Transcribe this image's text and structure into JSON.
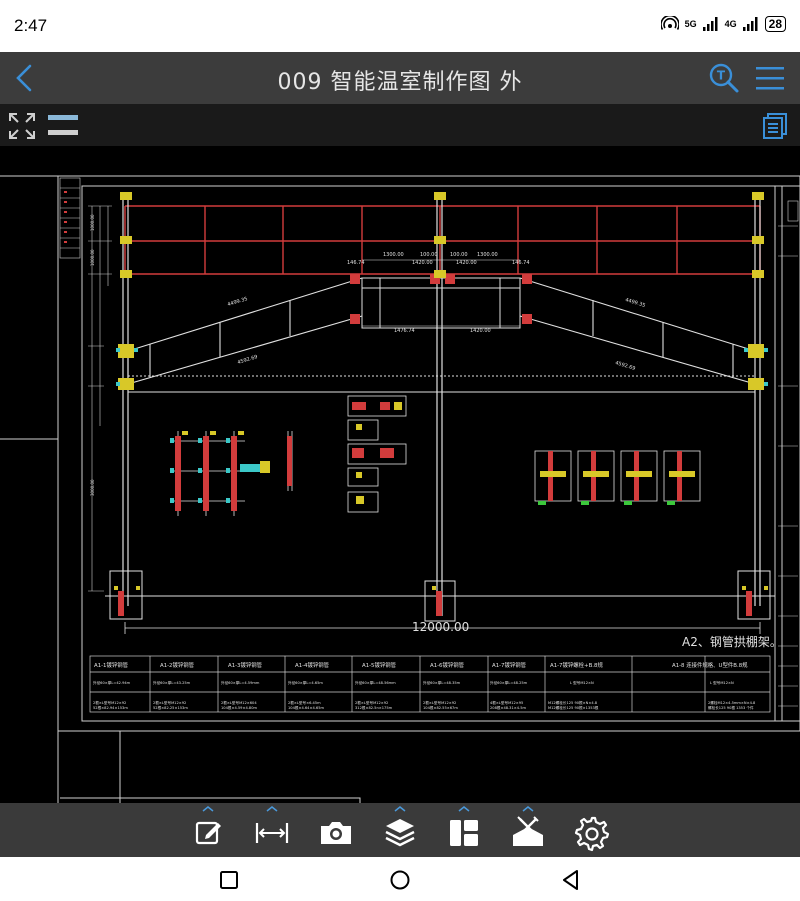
{
  "status": {
    "time": "2:47",
    "net1": "5G",
    "net2": "4G",
    "battery": "28"
  },
  "header": {
    "title": "009  智能温室制作图     外"
  },
  "drawing": {
    "span_label": "12000.00",
    "caption": "A2、钢管拱棚架。",
    "truss_left_top": "4499.35",
    "truss_left_bottom": "4592.69",
    "truss_right_top": "4499.35",
    "truss_right_bottom": "4592.69",
    "mid_dim_1": "1300.00",
    "mid_dim_2": "100.00",
    "mid_dim_3": "100.00",
    "mid_dim_4": "1300.00",
    "lower_dim_1": "1476.74",
    "lower_dim_2": "1420.00",
    "upper_dim_1": "1420.00",
    "upper_dim_2": "1420.00",
    "side_dim_left": "146.74",
    "side_dim_right": "146.74",
    "table_headers": [
      "A1-1镀锌钢管",
      "A1-2镀锌钢管",
      "A1-3镀锌钢管",
      "A1-4镀锌钢管",
      "A1-5镀锌钢管",
      "A1-6镀锌钢管",
      "A1-7镀锌钢管",
      "A1-7镀锌螺栓+B.8规",
      "A1-8 连接件规格、U型件B.8规"
    ],
    "table_row1": [
      "外径60×厚L=42.94m",
      "外径60×厚L=43.25m",
      "外径60×厚L=4.59mm",
      "外径60×厚L=4.65m",
      "外径60×厚L=48.56mm",
      "外径60×厚L=48.35m",
      "外径60×厚L=48.25m",
      "L 型号M12×N",
      "L 型号M12×N"
    ],
    "table_row2": [
      "2根×L型号M12×92",
      "2根×L型号M12×92",
      "2根×L型号M12×604",
      "2根×L型号×6.45m",
      "2根×L型号M12×92",
      "2根×L型号M12×92",
      "4根×L型号M12×95",
      "M12螺栓长125 90根×N×4.8",
      "2螺栓M12×4.5mm×N×4.8"
    ],
    "table_row3": [
      "52根×82.94×153m",
      "52根×82.25×153m",
      "104根×4.59×4.80m",
      "104根×4.64×4.65m",
      "312根×82.5n×175m",
      "104根×82.55×67m",
      "208根×48.31×4.5m",
      "M12螺栓长125 90根×1353根",
      "螺栓长125 90根 1353 个件"
    ]
  },
  "bottom_tools": [
    "edit-tool",
    "measure-tool",
    "screenshot-tool",
    "layers-tool",
    "layout-tool",
    "clear-tool",
    "settings-tool"
  ],
  "colors": {
    "titlebar": "#3c3c3c",
    "accent": "#3a8fd8",
    "cad_red": "#d23c3c",
    "cad_white": "#e0e0e0",
    "cad_cyan": "#3cc8c8",
    "cad_yellow": "#d8c828",
    "cad_green": "#3cc83c"
  }
}
